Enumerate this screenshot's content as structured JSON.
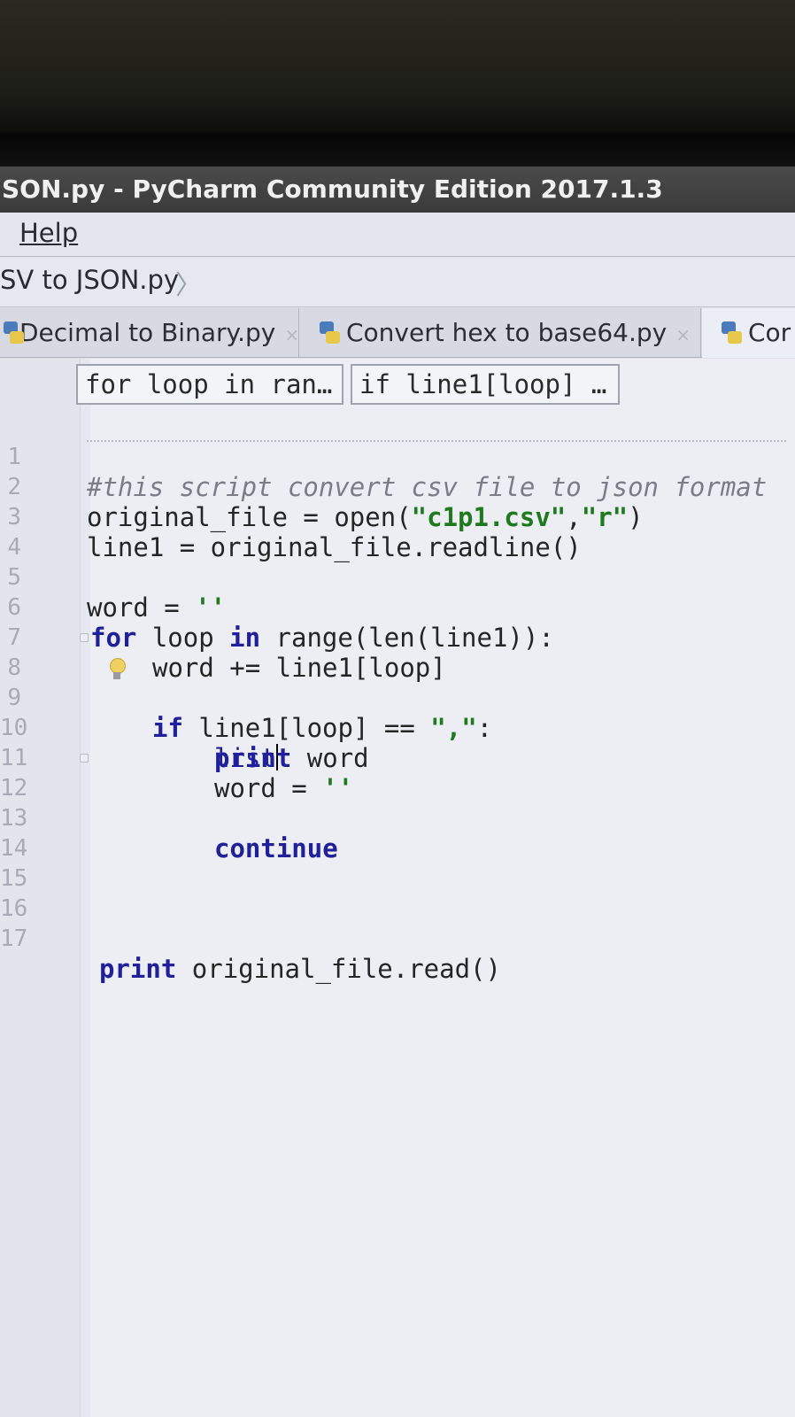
{
  "window": {
    "title": "SON.py - PyCharm Community Edition 2017.1.3"
  },
  "menu": {
    "items": [
      "Help"
    ]
  },
  "breadcrumb": {
    "file": "SV to JSON.py"
  },
  "tabs": [
    {
      "label": "Decimal to Binary.py",
      "close": "×"
    },
    {
      "label": "Convert hex to base64.py",
      "close": "×"
    },
    {
      "label": "Cor",
      "close": ""
    }
  ],
  "hints": [
    "for loop in ran…",
    "if line1[loop] …"
  ],
  "code": {
    "line_numbers": [
      "1",
      "2",
      "3",
      "4",
      "5",
      "6",
      "7",
      "8",
      "9",
      "10",
      "11",
      "12",
      "13",
      "14",
      "15",
      "16",
      "17"
    ],
    "l1": "#this script convert csv file to json format",
    "l2_a": "original_file = open(",
    "l2_s1": "\"c1p1.csv\"",
    "l2_b": ",",
    "l2_s2": "\"r\"",
    "l2_c": ")",
    "l3": "line1 = original_file.readline()",
    "l5_a": "word = ",
    "l5_s": "''",
    "l6_kw": "for",
    "l6_a": " loop ",
    "l6_kw2": "in",
    "l6_b": " range(len(line1)):",
    "l7": "word += line1[loop]",
    "l8_kw": "if",
    "l8_a": " line1[loop] == ",
    "l8_s": "\",\"",
    "l8_b": ":",
    "l9": "list",
    "l10_kw": "print",
    "l10_a": " word",
    "l11_a": "word = ",
    "l11_s": "''",
    "l12_kw": "continue",
    "l17_kw": "print",
    "l17_a": " original_file.read()"
  }
}
